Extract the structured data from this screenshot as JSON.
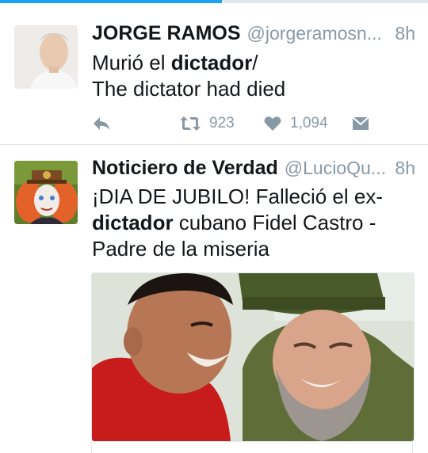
{
  "tweets": [
    {
      "display_name": "JORGE RAMOS",
      "handle": "@jorgeramosn...",
      "time": "8h",
      "text_lines": [
        [
          {
            "t": "Murió el "
          },
          {
            "t": "dictador",
            "b": true
          },
          {
            "t": "/"
          }
        ],
        [
          {
            "t": "The dictator had died"
          }
        ]
      ],
      "actions": {
        "retweet_count": "923",
        "like_count": "1,094"
      }
    },
    {
      "display_name": "Noticiero de Verdad",
      "handle": "@LucioQu...",
      "time": "8h",
      "text_lines": [
        [
          {
            "t": "¡DIA DE JUBILO! Falleció el ex-"
          }
        ],
        [
          {
            "t": "dictador",
            "b": true
          },
          {
            "t": " cubano Fidel Castro -"
          }
        ],
        [
          {
            "t": "Padre de la miseria"
          }
        ]
      ]
    }
  ],
  "colors": {
    "accent": "#1da1f2",
    "muted": "#8899a6",
    "divider": "#e1e8ed"
  }
}
